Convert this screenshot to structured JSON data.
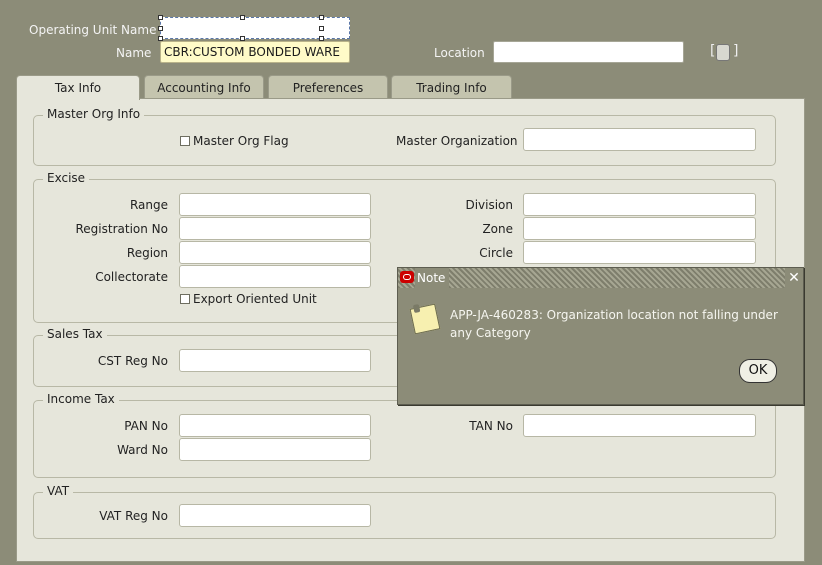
{
  "header": {
    "operating_unit_label": "Operating Unit Name",
    "operating_unit_value": "",
    "name_label": "Name",
    "name_value": "CBR:CUSTOM BONDED WARE",
    "location_label": "Location",
    "location_value": ""
  },
  "tabs": [
    {
      "label": "Tax Info",
      "active": true
    },
    {
      "label": "Accounting  Info",
      "active": false
    },
    {
      "label": "Preferences",
      "active": false
    },
    {
      "label": "Trading Info",
      "active": false
    }
  ],
  "master_org": {
    "title": "Master Org Info",
    "flag_label": "Master Org Flag",
    "flag_checked": false,
    "organization_label": "Master Organization",
    "organization_value": ""
  },
  "excise": {
    "title": "Excise",
    "range_label": "Range",
    "registration_label": "Registration No",
    "region_label": "Region",
    "collectorate_label": "Collectorate",
    "division_label": "Division",
    "zone_label": "Zone",
    "circle_label": "Circle",
    "export_label": "Export Oriented Unit",
    "export_checked": false
  },
  "sales_tax": {
    "title": "Sales Tax",
    "cst_label": "CST Reg No"
  },
  "income_tax": {
    "title": "Income Tax",
    "pan_label": "PAN No",
    "ward_label": "Ward No",
    "tan_label": "TAN No"
  },
  "vat": {
    "title": "VAT",
    "vat_label": "VAT Reg No"
  },
  "dialog": {
    "title": "Note",
    "message": "APP-JA-460283: Organization location not falling under any Category",
    "ok_label": "OK",
    "close_icon": "close-icon",
    "note_icon": "note-icon",
    "brand_icon": "oracle-logo-icon"
  },
  "colors": {
    "background": "#8c8c78",
    "panel": "#e6e6db",
    "active_field": "#fffbc8"
  }
}
